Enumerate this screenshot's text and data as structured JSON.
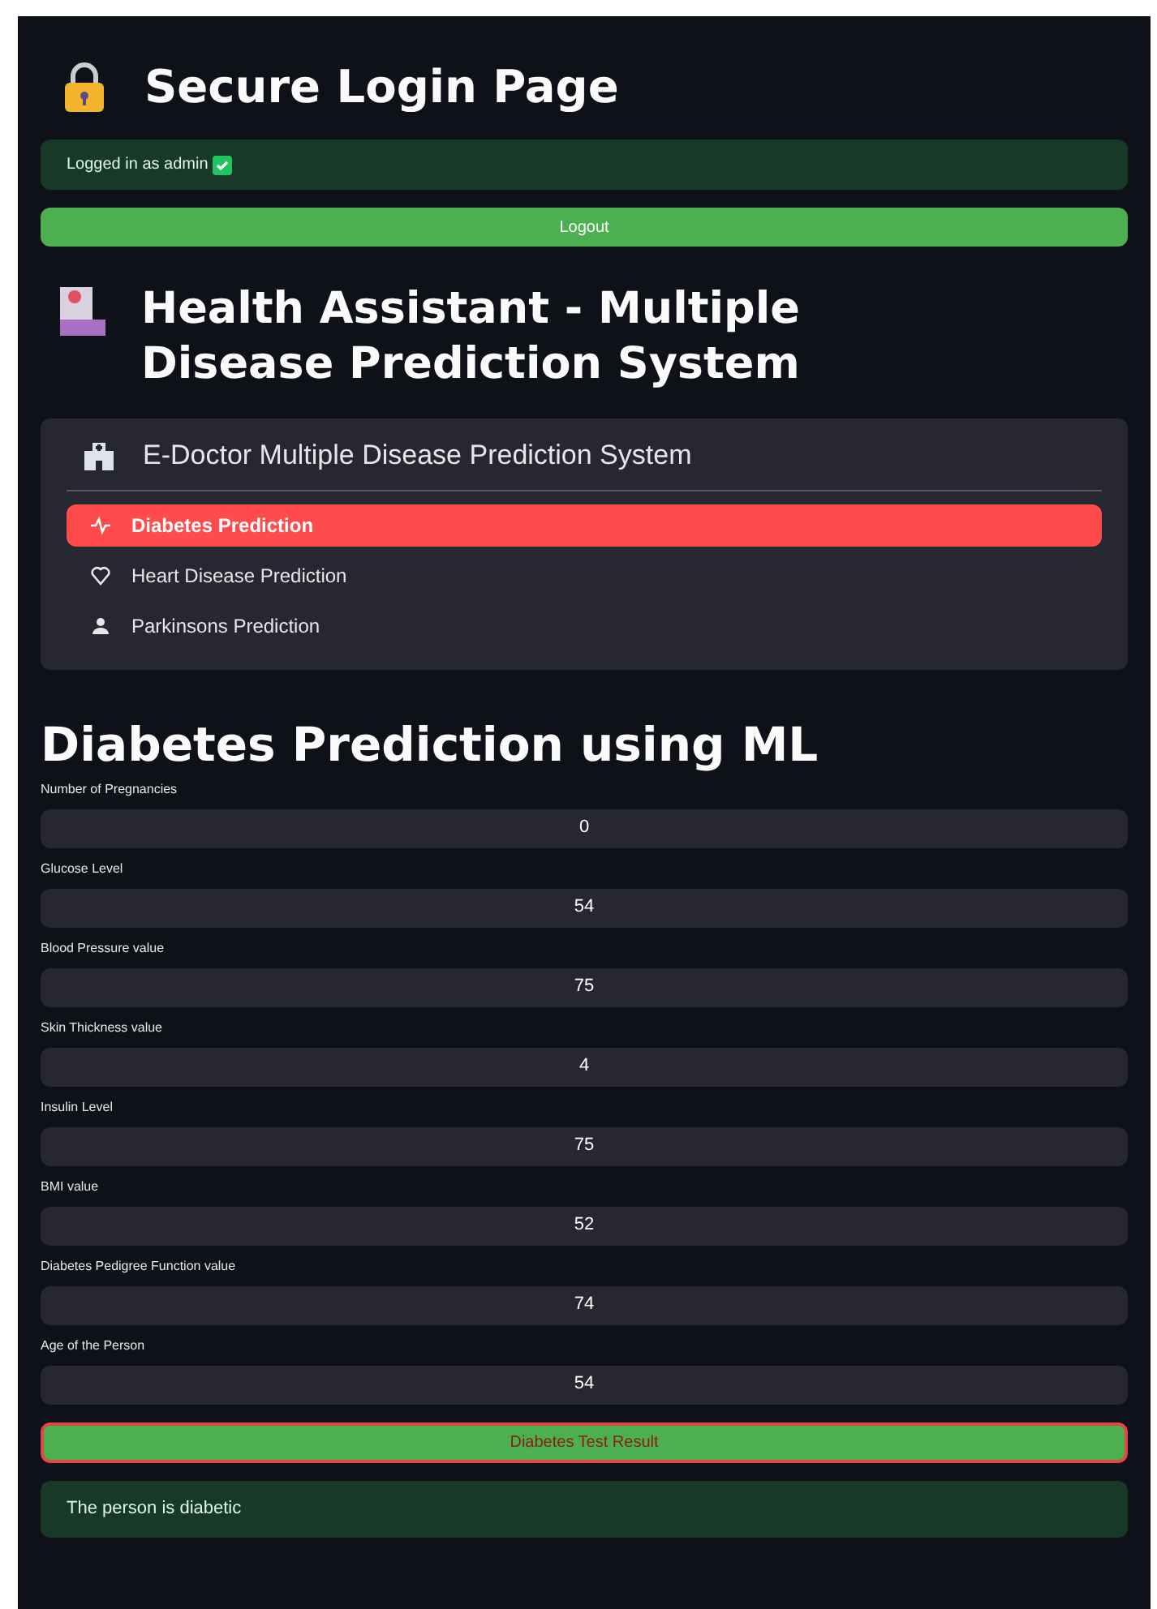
{
  "login": {
    "title": "Secure Login Page",
    "status": "Logged in as admin",
    "logout_button": "Logout"
  },
  "app_title": "Health Assistant - Multiple Disease Prediction System",
  "menu": {
    "title": "E-Doctor Multiple Disease Prediction System",
    "items": [
      {
        "label": "Diabetes Prediction",
        "kind": "pulse",
        "selected": true
      },
      {
        "label": "Heart Disease Prediction",
        "kind": "heart",
        "selected": false
      },
      {
        "label": "Parkinsons Prediction",
        "kind": "person",
        "selected": false
      }
    ]
  },
  "form": {
    "title": "Diabetes Prediction using ML",
    "fields": [
      {
        "label": "Number of Pregnancies",
        "value": "0"
      },
      {
        "label": "Glucose Level",
        "value": "54"
      },
      {
        "label": "Blood Pressure value",
        "value": "75"
      },
      {
        "label": "Skin Thickness value",
        "value": "4"
      },
      {
        "label": "Insulin Level",
        "value": "75"
      },
      {
        "label": "BMI value",
        "value": "52"
      },
      {
        "label": "Diabetes Pedigree Function value",
        "value": "74"
      },
      {
        "label": "Age of the Person",
        "value": "54"
      }
    ],
    "submit_button": "Diabetes Test Result",
    "result": "The person is diabetic"
  }
}
